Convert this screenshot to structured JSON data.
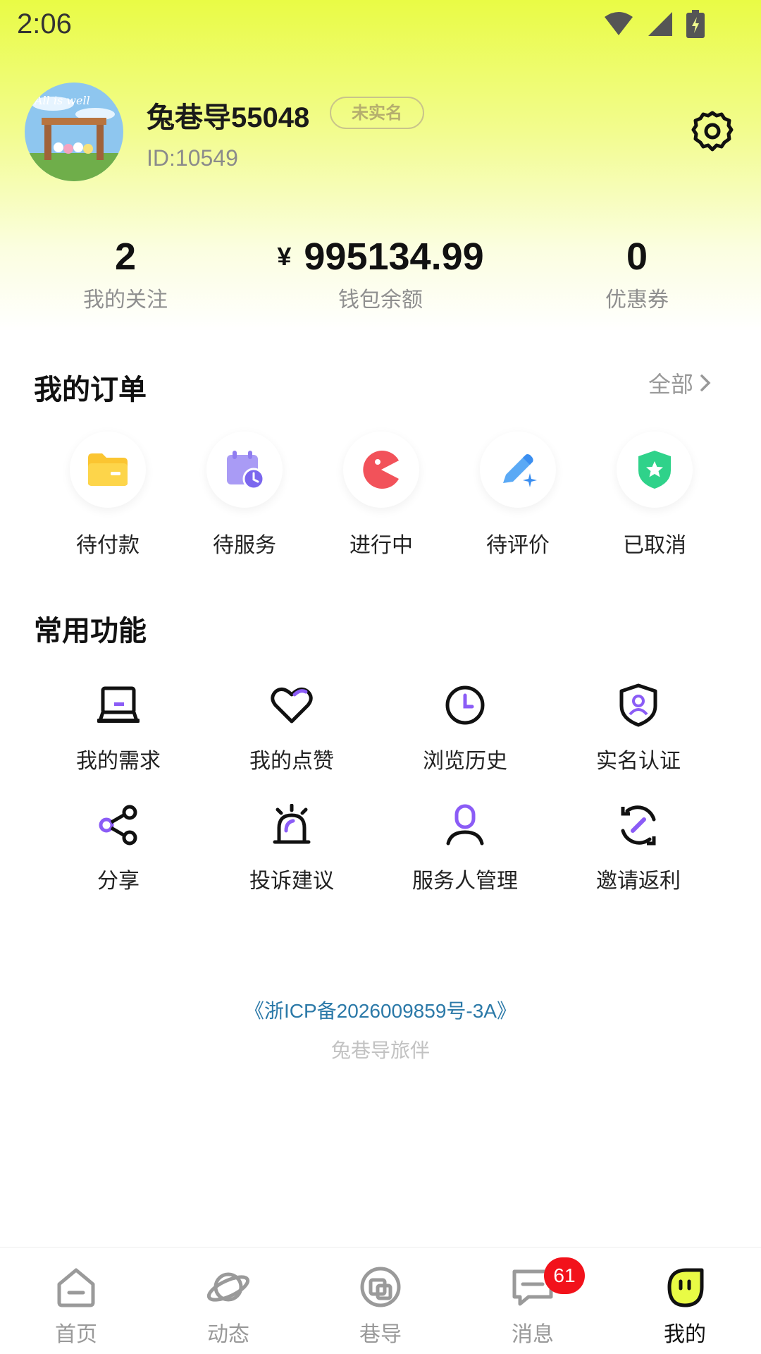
{
  "status_bar": {
    "time": "2:06"
  },
  "profile": {
    "username": "兔巷导55048",
    "verify_badge": "未实名",
    "user_id": "ID:10549",
    "avatar_text": "All is well"
  },
  "stats": {
    "following": {
      "value": "2",
      "label": "我的关注"
    },
    "wallet": {
      "currency": "¥",
      "value": "995134.99",
      "label": "钱包余额"
    },
    "coupons": {
      "value": "0",
      "label": "优惠券"
    }
  },
  "orders": {
    "title": "我的订单",
    "all_label": "全部",
    "items": [
      {
        "label": "待付款",
        "icon": "wallet-folder-icon"
      },
      {
        "label": "待服务",
        "icon": "calendar-clock-icon"
      },
      {
        "label": "进行中",
        "icon": "pacman-icon"
      },
      {
        "label": "待评价",
        "icon": "pen-sparkle-icon"
      },
      {
        "label": "已取消",
        "icon": "shield-star-icon"
      }
    ]
  },
  "functions": {
    "title": "常用功能",
    "items": [
      {
        "label": "我的需求",
        "icon": "laptop-icon"
      },
      {
        "label": "我的点赞",
        "icon": "heart-icon"
      },
      {
        "label": "浏览历史",
        "icon": "clock-icon"
      },
      {
        "label": "实名认证",
        "icon": "shield-user-icon"
      },
      {
        "label": "分享",
        "icon": "share-icon"
      },
      {
        "label": "投诉建议",
        "icon": "alarm-icon"
      },
      {
        "label": "服务人管理",
        "icon": "user-icon"
      },
      {
        "label": "邀请返利",
        "icon": "invite-link-icon"
      }
    ]
  },
  "footer": {
    "icp": "《浙ICP备2026009859号-3A》",
    "brand": "兔巷导旅伴"
  },
  "nav": {
    "items": [
      {
        "label": "首页",
        "icon": "home-icon"
      },
      {
        "label": "动态",
        "icon": "planet-icon"
      },
      {
        "label": "巷导",
        "icon": "guide-icon"
      },
      {
        "label": "消息",
        "icon": "message-icon",
        "badge": "61"
      },
      {
        "label": "我的",
        "icon": "profile-face-icon",
        "active": true
      }
    ]
  },
  "colors": {
    "accent_yellow": "#e9fb45",
    "purple": "#8b5cf6",
    "badge_red": "#f2121b"
  }
}
